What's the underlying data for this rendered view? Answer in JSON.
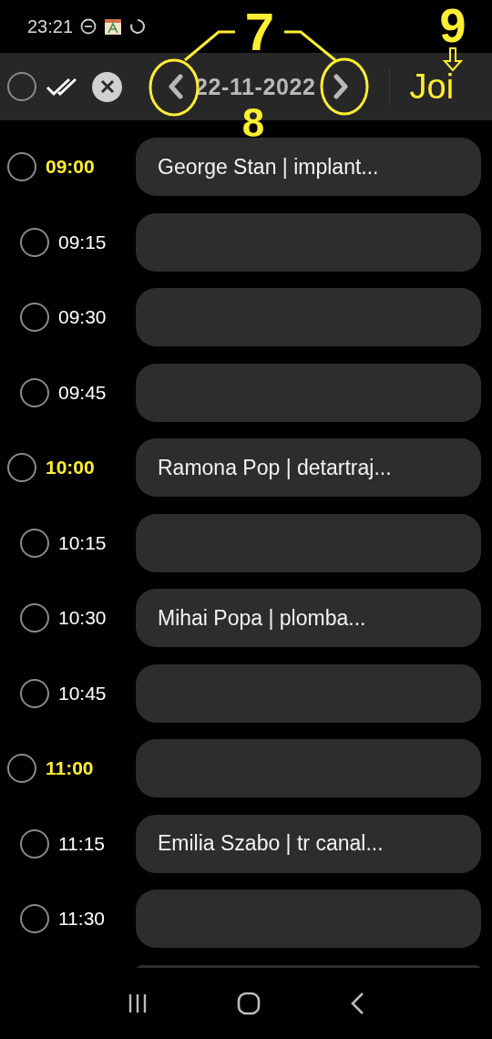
{
  "status_bar": {
    "time": "23:21"
  },
  "toolbar": {
    "select_all_checked": false,
    "date": "22-11-2022",
    "day": "Joi"
  },
  "slots": [
    {
      "time": "09:00",
      "kind": "hour",
      "checked": false,
      "text": "George Stan | implant..."
    },
    {
      "time": "09:15",
      "kind": "quarter",
      "checked": false
    },
    {
      "time": "09:30",
      "kind": "quarter",
      "checked": false
    },
    {
      "time": "09:45",
      "kind": "quarter",
      "checked": false
    },
    {
      "time": "10:00",
      "kind": "hour",
      "checked": false,
      "text": "Ramona Pop | detartraj..."
    },
    {
      "time": "10:15",
      "kind": "quarter",
      "checked": false
    },
    {
      "time": "10:30",
      "kind": "quarter",
      "checked": false,
      "text": "Mihai Popa | plomba..."
    },
    {
      "time": "10:45",
      "kind": "quarter",
      "checked": false
    },
    {
      "time": "11:00",
      "kind": "hour",
      "checked": false
    },
    {
      "time": "11:15",
      "kind": "quarter",
      "checked": false,
      "text": "Emilia Szabo | tr canal..."
    },
    {
      "time": "11:30",
      "kind": "quarter",
      "checked": false
    }
  ],
  "annotations": [
    {
      "label": "7",
      "kind": "nav"
    },
    {
      "label": "8",
      "kind": "date"
    },
    {
      "label": "9",
      "kind": "day"
    }
  ]
}
